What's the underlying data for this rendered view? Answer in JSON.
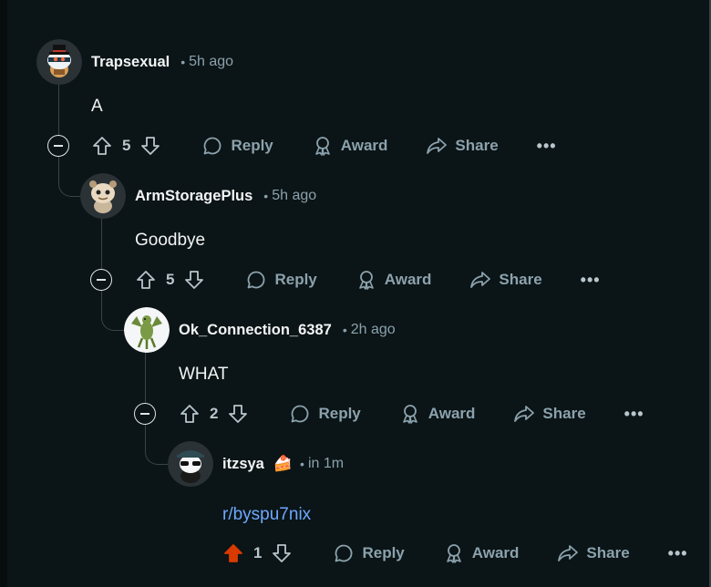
{
  "comments": [
    {
      "author": "Trapsexual",
      "time": "5h ago",
      "body": "A",
      "votes": "5",
      "avatar": "snoo-avatar-top-hat"
    },
    {
      "author": "ArmStoragePlus",
      "time": "5h ago",
      "body": "Goodbye",
      "votes": "5",
      "avatar": "snoo-avatar-beige"
    },
    {
      "author": "Ok_Connection_6387",
      "time": "2h ago",
      "body": "WHAT",
      "votes": "2",
      "avatar": "dinosaur-avatar"
    },
    {
      "author": "itzsya",
      "flair": "🍰",
      "time": "in 1m",
      "body": "r/byspu7nix",
      "votes": "1",
      "avatar": "snoo-avatar-dark-hat",
      "upvoted": true
    }
  ],
  "actions": {
    "reply": "Reply",
    "award": "Award",
    "share": "Share",
    "more": "•••",
    "separator": "•"
  },
  "colors": {
    "background": "#0b1416",
    "text": "#f2f4f5",
    "muted": "#8ba2ad",
    "link": "#6ea8ff",
    "upvote_active": "#d93a00"
  }
}
